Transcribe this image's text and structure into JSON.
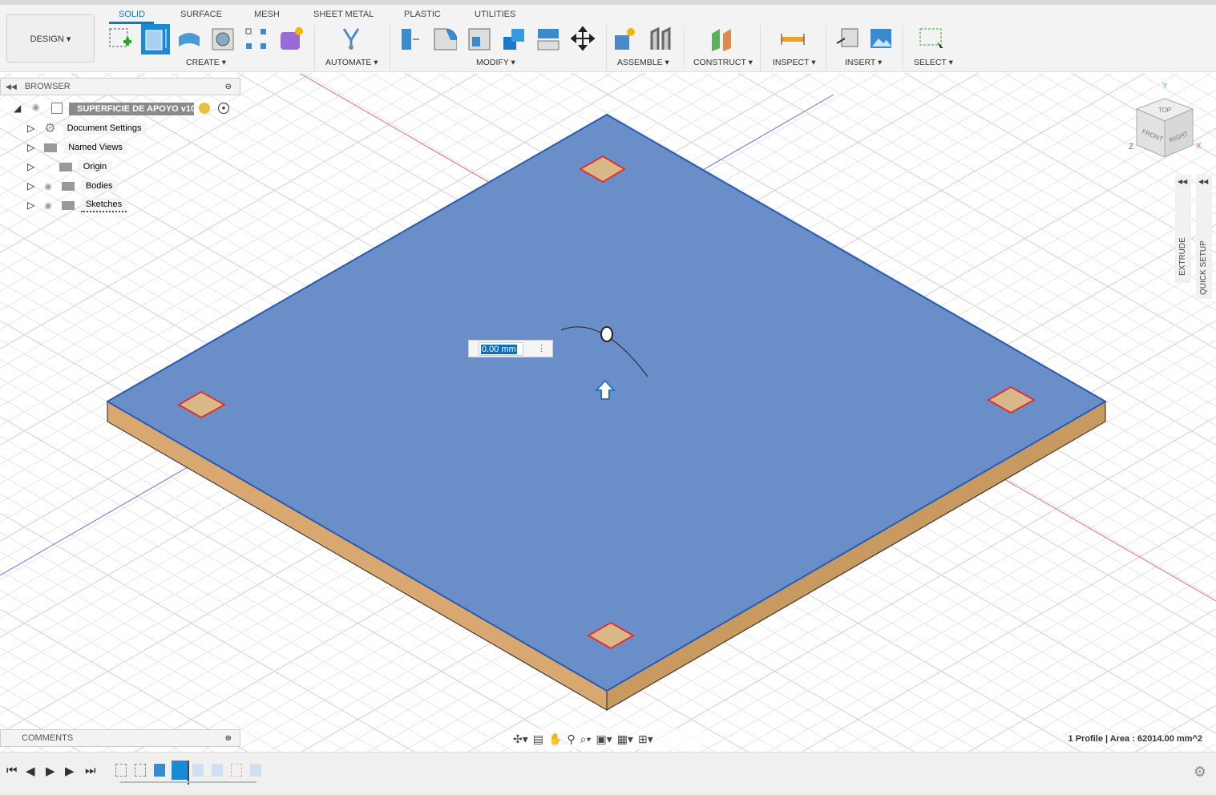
{
  "toolbar": {
    "workspace": "DESIGN ▾",
    "tabs": [
      "SOLID",
      "SURFACE",
      "MESH",
      "SHEET METAL",
      "PLASTIC",
      "UTILITIES"
    ],
    "active_tab": "SOLID",
    "groups": [
      "CREATE ▾",
      "AUTOMATE ▾",
      "MODIFY ▾",
      "ASSEMBLE ▾",
      "CONSTRUCT ▾",
      "INSPECT ▾",
      "INSERT ▾",
      "SELECT ▾"
    ]
  },
  "browser": {
    "title": "BROWSER",
    "root": "SUPERFICIE DE APOYO v10",
    "items": [
      {
        "label": "Document Settings",
        "icon": "gear-icon"
      },
      {
        "label": "Named Views",
        "icon": "folder-icon"
      },
      {
        "label": "Origin",
        "icon": "folder-icon",
        "visible": false
      },
      {
        "label": "Bodies",
        "icon": "folder-icon",
        "visible": true
      },
      {
        "label": "Sketches",
        "icon": "folder-icon",
        "visible": true
      }
    ]
  },
  "comments": {
    "title": "COMMENTS"
  },
  "extrude_input": {
    "value": "0.00 mm"
  },
  "side_panels": {
    "extrude": "EXTRUDE",
    "quick_setup": "QUICK SETUP"
  },
  "viewcube": {
    "top": "TOP",
    "front": "FRONT",
    "right": "RIGHT",
    "x": "X",
    "y": "Y",
    "z": "Z"
  },
  "status": "1 Profile | Area : 62014.00 mm^2",
  "colors": {
    "accent": "#0a7bc2",
    "face": "#6a8fc8",
    "side": "#d8a870",
    "axis_x": "#e06060",
    "axis_z": "#6060e0"
  }
}
